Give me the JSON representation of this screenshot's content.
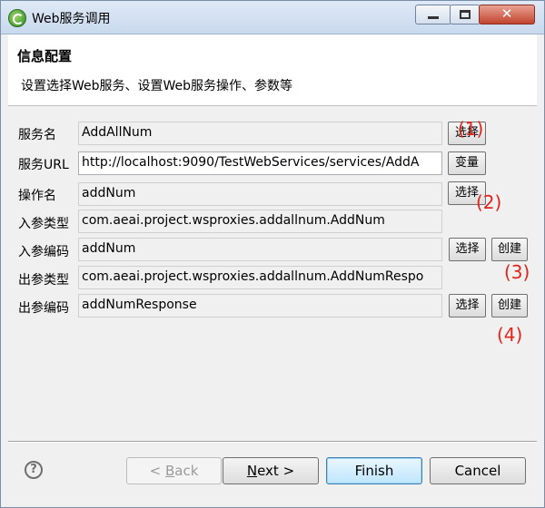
{
  "window": {
    "title": "Web服务调用",
    "close_glyph": "✕"
  },
  "header": {
    "title": "信息配置",
    "description": "设置选择Web服务、设置Web服务操作、参数等"
  },
  "form": {
    "service_name": {
      "label": "服务名",
      "value": "AddAllNum",
      "button": "选择",
      "annotation": "(1)"
    },
    "service_url": {
      "label": "服务URL",
      "value": "http://localhost:9090/TestWebServices/services/AddA",
      "button": "变量"
    },
    "operation": {
      "label": "操作名",
      "value": "addNum",
      "button": "选择",
      "annotation": "(2)"
    },
    "input_type": {
      "label": "入参类型",
      "value": "com.aeai.project.wsproxies.addallnum.AddNum"
    },
    "input_code": {
      "label": "入参编码",
      "value": "addNum",
      "select_button": "选择",
      "create_button": "创建",
      "annotation": "(3)"
    },
    "output_type": {
      "label": "出参类型",
      "value": "com.aeai.project.wsproxies.addallnum.AddNumRespo"
    },
    "output_code": {
      "label": "出参编码",
      "value": "addNumResponse",
      "select_button": "选择",
      "create_button": "创建",
      "annotation": "(4)"
    }
  },
  "footer": {
    "help": "?",
    "back": {
      "prefix": "< ",
      "mnemonic": "B",
      "rest": "ack"
    },
    "next": {
      "mnemonic": "N",
      "rest": "ext >"
    },
    "finish": "Finish",
    "cancel": "Cancel"
  }
}
